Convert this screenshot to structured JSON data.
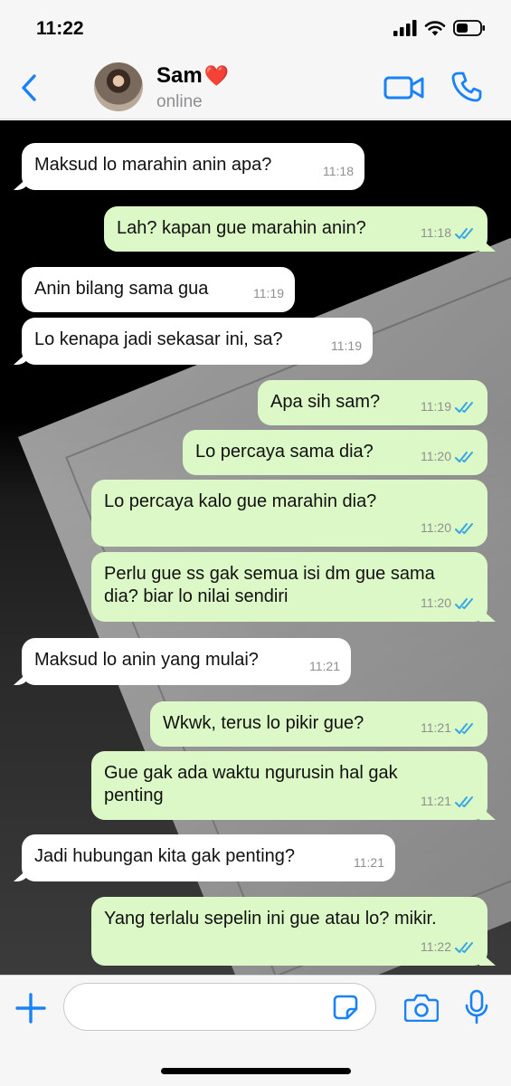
{
  "status_bar": {
    "time": "11:22"
  },
  "header": {
    "contact_name": "Sam",
    "heart": "❤️",
    "contact_status": "online",
    "icons": [
      "back-icon",
      "video-call-icon",
      "phone-icon"
    ]
  },
  "messages": [
    {
      "direction": "in",
      "text": "Maksud lo marahin anin apa?",
      "time": "11:18"
    },
    {
      "direction": "out",
      "text": "Lah? kapan gue marahin anin?",
      "time": "11:18",
      "read": true
    },
    {
      "direction": "in",
      "text": "Anin bilang sama gua",
      "time": "11:19"
    },
    {
      "direction": "in",
      "text": "Lo kenapa jadi sekasar ini, sa?",
      "time": "11:19"
    },
    {
      "direction": "out",
      "text": "Apa sih sam?",
      "time": "11:19",
      "read": true
    },
    {
      "direction": "out",
      "text": "Lo percaya sama dia?",
      "time": "11:20",
      "read": true
    },
    {
      "direction": "out",
      "text": "Lo percaya kalo gue marahin dia?",
      "time": "11:20",
      "read": true
    },
    {
      "direction": "out",
      "text": "Perlu gue ss gak semua isi dm gue sama dia? biar lo nilai sendiri",
      "time": "11:20",
      "read": true
    },
    {
      "direction": "in",
      "text": "Maksud lo anin yang mulai?",
      "time": "11:21"
    },
    {
      "direction": "out",
      "text": "Wkwk, terus lo pikir gue?",
      "time": "11:21",
      "read": true
    },
    {
      "direction": "out",
      "text": "Gue gak ada waktu ngurusin hal gak penting",
      "time": "11:21",
      "read": true
    },
    {
      "direction": "in",
      "text": "Jadi hubungan kita gak penting?",
      "time": "11:21"
    },
    {
      "direction": "out",
      "text": "Yang terlalu sepelin ini gue atau lo? mikir.",
      "time": "11:22",
      "read": true
    }
  ],
  "input_bar": {
    "placeholder": ""
  },
  "colors": {
    "accent": "#1a82f7",
    "outgoing_bubble": "#dcf8c6",
    "incoming_bubble": "#ffffff",
    "read_ticks": "#34a7e5"
  }
}
